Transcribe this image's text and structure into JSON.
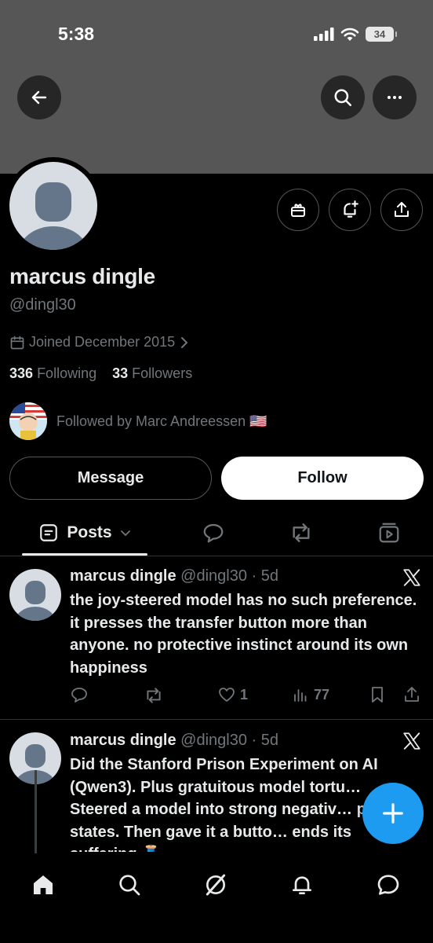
{
  "status_bar": {
    "time": "5:38",
    "battery": "34"
  },
  "profile": {
    "name": "marcus dingle",
    "handle": "@dingl30",
    "joined": "Joined December 2015",
    "following_count": "336",
    "following_label": "Following",
    "followers_count": "33",
    "followers_label": "Followers",
    "followed_by": "Followed by Marc Andreessen 🇺🇸"
  },
  "buttons": {
    "message": "Message",
    "follow": "Follow"
  },
  "tabs": {
    "posts": "Posts"
  },
  "posts": [
    {
      "name": "marcus dingle",
      "handle": "@dingl30",
      "time": "· 5d",
      "text": "the joy-steered model has no such preference. it presses the transfer button more than anyone. no protective instinct around its own happiness",
      "likes": "1",
      "views": "77"
    },
    {
      "name": "marcus dingle",
      "handle": "@dingl30",
      "time": "· 5d",
      "text": "Did the Stanford Prison Experiment on AI (Qwen3).  Plus gratuitous model tortu… Steered a model into strong negativ… positive states. Then gave it a butto… ends its suffering 🧵"
    }
  ],
  "icons": {
    "back": "back-arrow-icon",
    "search": "search-icon",
    "more": "more-icon",
    "gift": "gift-icon",
    "notify": "bell-plus-icon",
    "share": "share-icon",
    "calendar": "calendar-icon",
    "x": "x-logo-icon"
  },
  "colors": {
    "accent": "#1d9bf0",
    "muted": "#71767b",
    "banner": "#565656"
  }
}
